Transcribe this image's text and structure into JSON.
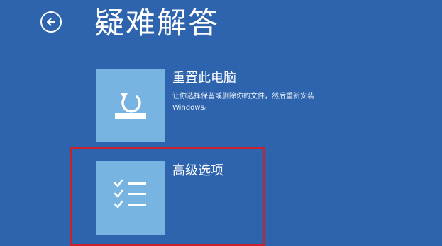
{
  "header": {
    "title": "疑难解答",
    "back_icon": "back-arrow-icon"
  },
  "options": [
    {
      "title": "重置此电脑",
      "description": "让你选择保留或删除你的文件，然后重新安装 Windows。",
      "icon": "reset-pc-icon"
    },
    {
      "title": "高级选项",
      "description": "",
      "icon": "checklist-icon"
    }
  ],
  "colors": {
    "background": "#2d64ad",
    "tile": "#77b4e1",
    "text": "#ffffff",
    "highlight": "#c8232c"
  }
}
